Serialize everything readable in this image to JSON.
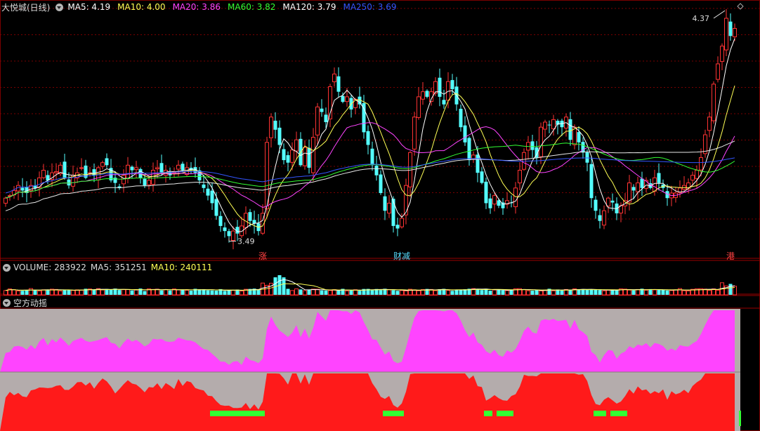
{
  "stock": {
    "title": "大悦城(日线)"
  },
  "price_ma": [
    {
      "label": "MA5: 4.19",
      "color": "#ffffff"
    },
    {
      "label": "MA10: 4.00",
      "color": "#ffff55"
    },
    {
      "label": "MA20: 3.86",
      "color": "#ff44ff"
    },
    {
      "label": "MA60: 3.82",
      "color": "#33ff33"
    },
    {
      "label": "MA120: 3.79",
      "color": "#ffffff"
    },
    {
      "label": "MA250: 3.69",
      "color": "#3355ff"
    }
  ],
  "volume_header": {
    "volume": "VOLUME: 283922",
    "ma5": "MA5: 351251",
    "ma10": "MA10: 240111"
  },
  "indicator_header": {
    "title": "空方动摇"
  },
  "annotations": {
    "high": "4.37",
    "low": "3.49"
  },
  "event_tags": [
    {
      "text": "涨",
      "color": "#ff4444",
      "bar": 61
    },
    {
      "text": "财",
      "color": "#55ddff",
      "bar": 93
    },
    {
      "text": "减",
      "color": "#55ddff",
      "bar": 95
    },
    {
      "text": "港",
      "color": "#ff4444",
      "bar": 172
    }
  ],
  "colors": {
    "up": "#ff3333",
    "down": "#54ffff",
    "grid": "#7a0000",
    "panel_bg": "#b4acac",
    "magenta": "#ff44ff",
    "red": "#ff1a1a",
    "green": "#33ff33"
  },
  "chart_data": {
    "type": "candlestick",
    "price_range": [
      3.45,
      4.42
    ],
    "closes": [
      3.66,
      3.67,
      3.69,
      3.71,
      3.69,
      3.68,
      3.71,
      3.7,
      3.74,
      3.77,
      3.73,
      3.76,
      3.76,
      3.79,
      3.74,
      3.71,
      3.75,
      3.76,
      3.78,
      3.74,
      3.76,
      3.75,
      3.78,
      3.8,
      3.79,
      3.73,
      3.72,
      3.7,
      3.75,
      3.79,
      3.77,
      3.78,
      3.74,
      3.71,
      3.73,
      3.77,
      3.78,
      3.76,
      3.77,
      3.75,
      3.76,
      3.79,
      3.77,
      3.78,
      3.77,
      3.76,
      3.73,
      3.7,
      3.67,
      3.64,
      3.59,
      3.55,
      3.53,
      3.51,
      3.53,
      3.52,
      3.55,
      3.6,
      3.57,
      3.56,
      3.53,
      3.6,
      3.88,
      3.98,
      3.93,
      3.87,
      3.81,
      3.8,
      3.85,
      3.89,
      3.79,
      3.86,
      3.78,
      3.9,
      4.02,
      4.0,
      3.96,
      4.1,
      4.15,
      4.08,
      4.04,
      4.06,
      4.01,
      4.05,
      4.03,
      3.92,
      3.87,
      3.79,
      3.75,
      3.68,
      3.61,
      3.64,
      3.55,
      3.54,
      3.58,
      3.71,
      3.84,
      3.98,
      4.06,
      4.08,
      4.06,
      4.08,
      4.12,
      4.06,
      4.03,
      4.12,
      4.09,
      4.03,
      3.94,
      3.88,
      3.81,
      3.83,
      3.76,
      3.72,
      3.64,
      3.62,
      3.67,
      3.63,
      3.62,
      3.65,
      3.64,
      3.7,
      3.77,
      3.84,
      3.88,
      3.85,
      3.82,
      3.94,
      3.96,
      3.95,
      3.97,
      3.95,
      3.94,
      3.98,
      3.89,
      3.94,
      3.88,
      3.84,
      3.8,
      3.66,
      3.61,
      3.57,
      3.61,
      3.66,
      3.65,
      3.6,
      3.63,
      3.65,
      3.72,
      3.69,
      3.72,
      3.7,
      3.73,
      3.7,
      3.74,
      3.72,
      3.7,
      3.66,
      3.68,
      3.68,
      3.7,
      3.71,
      3.72,
      3.75,
      3.77,
      3.82,
      3.91,
      3.98,
      4.11,
      4.19,
      4.26,
      4.37,
      4.3,
      4.33
    ]
  }
}
